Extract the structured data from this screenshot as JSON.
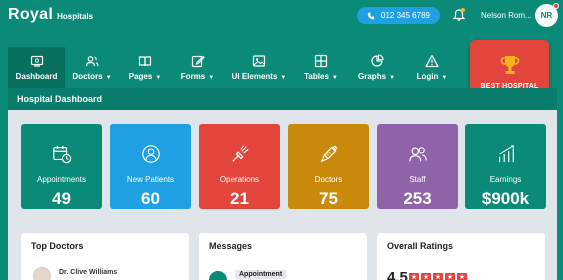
{
  "brand": {
    "name": "Royal",
    "sub": "Hospitals"
  },
  "header": {
    "phone": "012 345 6789",
    "user_name": "Nelson Rom...",
    "user_initials": "NR"
  },
  "nav": {
    "items": [
      {
        "label": "Dashboard",
        "icon": "dashboard-icon",
        "caret": ""
      },
      {
        "label": "Doctors",
        "icon": "users-icon",
        "caret": "▼"
      },
      {
        "label": "Pages",
        "icon": "book-icon",
        "caret": "▼"
      },
      {
        "label": "Forms",
        "icon": "edit-icon",
        "caret": "▼"
      },
      {
        "label": "UI Elements",
        "icon": "image-icon",
        "caret": "▼"
      },
      {
        "label": "Tables",
        "icon": "grid-icon",
        "caret": "▼"
      },
      {
        "label": "Graphs",
        "icon": "pie-chart-icon",
        "caret": "▼"
      },
      {
        "label": "Login",
        "icon": "warning-icon",
        "caret": "▼"
      }
    ]
  },
  "best_hospital": {
    "label": "BEST HOSPITAL",
    "icon": "trophy-icon"
  },
  "page": {
    "title": "Hospital Dashboard"
  },
  "stats": [
    {
      "label": "Appointments",
      "value": "49",
      "color": "#0b8a78",
      "icon": "calendar-clock-icon"
    },
    {
      "label": "New Patients",
      "value": "60",
      "color": "#1ea0e3",
      "icon": "patient-icon"
    },
    {
      "label": "Operations",
      "value": "21",
      "color": "#e2453c",
      "icon": "surgery-icon"
    },
    {
      "label": "Doctors",
      "value": "75",
      "color": "#c98a0b",
      "icon": "syringe-icon"
    },
    {
      "label": "Staff",
      "value": "253",
      "color": "#8e63a8",
      "icon": "staff-icon"
    },
    {
      "label": "Earnings",
      "value": "$900k",
      "color": "#0b8a78",
      "icon": "growth-icon"
    }
  ],
  "panels": {
    "top_doctors": {
      "title": "Top Doctors",
      "first_doctor": "Dr. Clive Williams"
    },
    "messages": {
      "title": "Messages",
      "badge": "Appointment"
    },
    "ratings": {
      "title": "Overall Ratings",
      "value": "4.5",
      "stars": 5
    }
  },
  "colors": {
    "primary": "#0b8a78",
    "accent_red": "#e2453c",
    "accent_blue": "#1ea0e3",
    "content_bg": "#dfe5ea"
  }
}
